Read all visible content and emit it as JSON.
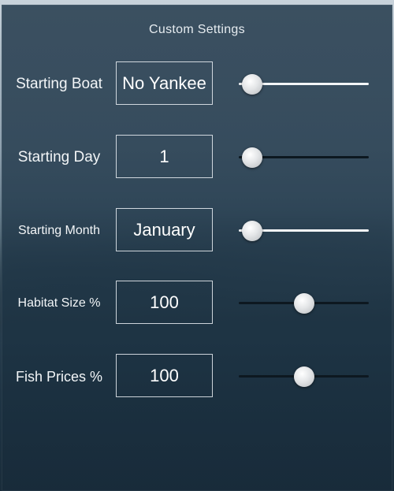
{
  "title": "Custom Settings",
  "settings": [
    {
      "label": "Starting Boat",
      "value": "No Yankee",
      "slider_position": 0.1,
      "track": "light"
    },
    {
      "label": "Starting Day",
      "value": "1",
      "slider_position": 0.1,
      "track": "dark"
    },
    {
      "label": "Starting Month",
      "value": "January",
      "slider_position": 0.1,
      "track": "light"
    },
    {
      "label": "Habitat Size %",
      "value": "100",
      "slider_position": 0.5,
      "track": "dark"
    },
    {
      "label": "Fish Prices %",
      "value": "100",
      "slider_position": 0.5,
      "track": "dark"
    }
  ]
}
